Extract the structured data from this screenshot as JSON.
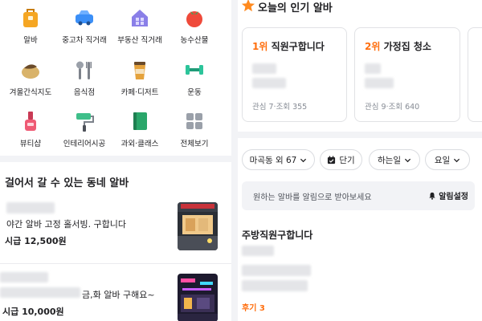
{
  "categories": [
    {
      "label": "알바",
      "icon": "bag-icon"
    },
    {
      "label": "중고차 직거래",
      "icon": "car-icon"
    },
    {
      "label": "부동산 직거래",
      "icon": "house-icon"
    },
    {
      "label": "농수산물",
      "icon": "tomato-icon"
    },
    {
      "label": "겨울간식지도",
      "icon": "snack-icon"
    },
    {
      "label": "음식점",
      "icon": "utensils-icon"
    },
    {
      "label": "카페·디저트",
      "icon": "coffee-cup-icon"
    },
    {
      "label": "운동",
      "icon": "dumbbell-icon"
    },
    {
      "label": "뷰티샵",
      "icon": "nail-polish-icon"
    },
    {
      "label": "인테리어시공",
      "icon": "paint-roller-icon"
    },
    {
      "label": "과외·클래스",
      "icon": "book-icon"
    },
    {
      "label": "전체보기",
      "icon": "grid-icon"
    }
  ],
  "nearby": {
    "title": "걸어서 갈 수 있는 동네 알바",
    "jobs": [
      {
        "title": "야간 알바 고정 홀서빙. 구합니다",
        "pay": "시급 12,500원",
        "thumb": "storefront-photo"
      },
      {
        "title": "금,화 알바 구해요~",
        "pay": "시급 10,000원",
        "thumb": "neon-bar-photo"
      }
    ]
  },
  "popular": {
    "title": "오늘의 인기 알바",
    "icon": "star-burst-icon",
    "cards": [
      {
        "rank": "1위",
        "label": "직원구합니다",
        "meta": "관심 7·조회 355"
      },
      {
        "rank": "2위",
        "label": "가정집 청소",
        "meta": "관심 9·조회 640"
      }
    ]
  },
  "filters": [
    {
      "label": "마곡동 외 67",
      "icon": "chevron-down-icon"
    },
    {
      "label": "단기",
      "icon": "calendar-check-icon"
    },
    {
      "label": "하는일",
      "icon": "chevron-down-icon"
    },
    {
      "label": "요일",
      "icon": "chevron-down-icon"
    }
  ],
  "alert": {
    "text": "원하는 알바를 알림으로 받아보세요",
    "button": "알림설정",
    "icon": "bell-icon"
  },
  "listing": {
    "title": "주방직원구합니다",
    "review": "후기 3"
  },
  "colors": {
    "accent": "#ff6f0f",
    "text": "#212124",
    "muted": "#868b94",
    "bg_gray": "#f2f3f6"
  }
}
